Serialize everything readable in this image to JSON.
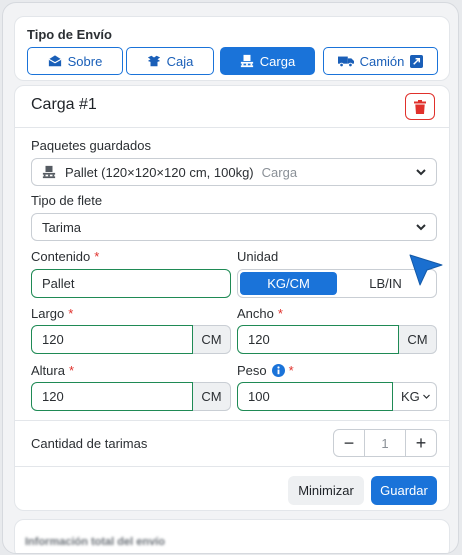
{
  "shipping_type": {
    "title": "Tipo de Envío",
    "options": [
      {
        "label": "Sobre",
        "icon": "envelope-icon",
        "active": false
      },
      {
        "label": "Caja",
        "icon": "box-icon",
        "active": false
      },
      {
        "label": "Carga",
        "icon": "pallet-icon",
        "active": true
      },
      {
        "label": "Camión",
        "icon": "truck-icon",
        "active": false
      }
    ]
  },
  "cargo": {
    "title": "Carga #1",
    "saved_packages": {
      "label": "Paquetes guardados",
      "value": "Pallet (120×120×120 cm, 100kg)",
      "tag": "Carga"
    },
    "freight_type": {
      "label": "Tipo de flete",
      "value": "Tarima"
    },
    "contents": {
      "label": "Contenido",
      "required": "*",
      "value": "Pallet"
    },
    "unit": {
      "label": "Unidad",
      "options": [
        "KG/CM",
        "LB/IN"
      ],
      "selected": "KG/CM"
    },
    "length": {
      "label": "Largo",
      "required": "*",
      "value": "120",
      "unit": "CM"
    },
    "width": {
      "label": "Ancho",
      "required": "*",
      "value": "120",
      "unit": "CM"
    },
    "height": {
      "label": "Altura",
      "required": "*",
      "value": "120",
      "unit": "CM"
    },
    "weight": {
      "label": "Peso",
      "required": "*",
      "value": "100",
      "unit": "KG"
    },
    "pallet_qty": {
      "label": "Cantidad de tarimas",
      "value": "1",
      "minus": "−",
      "plus": "+"
    },
    "actions": {
      "minimize": "Minimizar",
      "save": "Guardar"
    }
  },
  "footer": {
    "title": "Información total del envío"
  },
  "colors": {
    "primary": "#1a73d9",
    "danger": "#e0302b",
    "valid_border": "#1f8a55"
  }
}
